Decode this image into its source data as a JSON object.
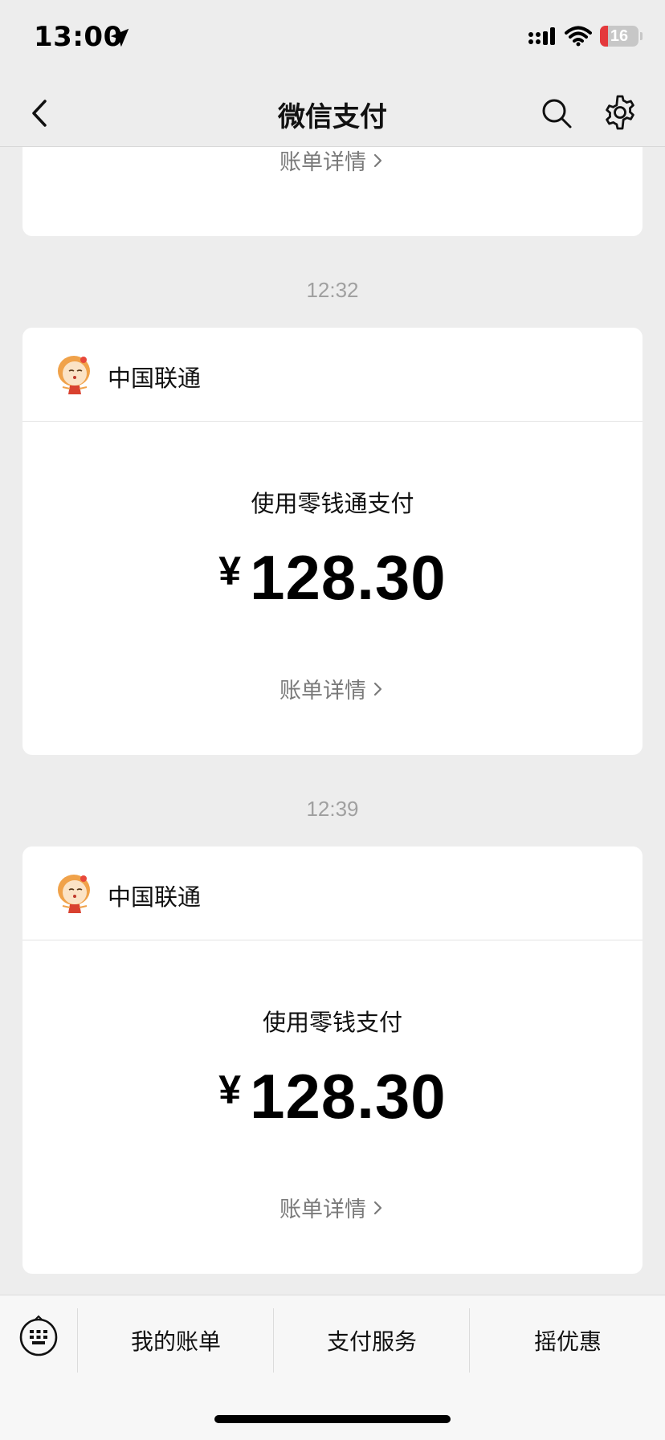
{
  "status_bar": {
    "time": "13:00",
    "battery": "16"
  },
  "nav": {
    "title": "微信支付"
  },
  "messages": [
    {
      "bill_link": "账单详情"
    },
    {
      "time": "12:32",
      "merchant": "中国联通",
      "method": "使用零钱通支付",
      "currency": "¥",
      "amount": "128.30",
      "bill_link": "账单详情"
    },
    {
      "time": "12:39",
      "merchant": "中国联通",
      "method": "使用零钱支付",
      "currency": "¥",
      "amount": "128.30",
      "bill_link": "账单详情"
    }
  ],
  "bottom_menu": {
    "items": [
      {
        "label": "我的账单"
      },
      {
        "label": "支付服务"
      },
      {
        "label": "摇优惠"
      }
    ]
  },
  "icons": {
    "status": [
      "location-arrow-icon",
      "cellular-signal-icon",
      "wifi-icon",
      "battery-icon"
    ],
    "nav": [
      "back-chevron-icon",
      "search-icon",
      "gear-icon"
    ],
    "bottom": [
      "keyboard-icon"
    ]
  },
  "colors": {
    "background": "#ededed",
    "card": "#ffffff",
    "muted_text": "#7a7a7a",
    "time_text": "#a0a0a0",
    "battery_low": "#e4393c"
  }
}
